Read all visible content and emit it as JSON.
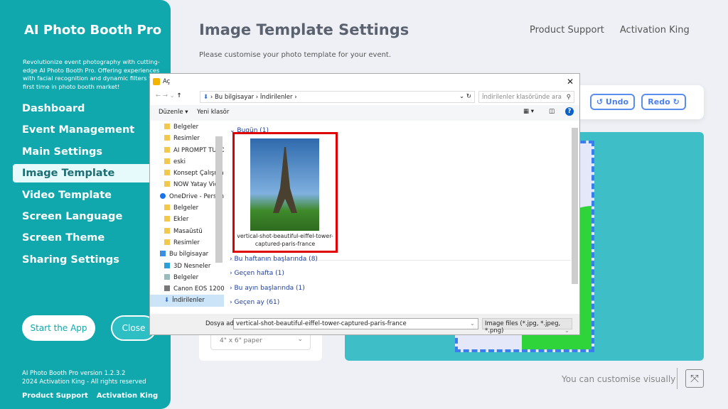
{
  "sidebar": {
    "brand": "AI Photo Booth Pro",
    "description": "Revolutionize event photography with cutting-edge AI Photo Booth Pro. Offering experiences with facial recognition and dynamic filters for the first time in photo booth market!",
    "items": [
      {
        "label": "Dashboard"
      },
      {
        "label": "Event Management"
      },
      {
        "label": "Main Settings"
      },
      {
        "label": "Image Template",
        "active": true
      },
      {
        "label": "Video Template"
      },
      {
        "label": "Screen Language"
      },
      {
        "label": "Screen Theme"
      },
      {
        "label": "Sharing Settings"
      }
    ],
    "start_label": "Start the App",
    "close_label": "Close",
    "version": "AI Photo Booth Pro version 1.2.3.2",
    "copyright": "2024 Activation King - All rights reserved",
    "support_link": "Product Support",
    "king_link": "Activation King"
  },
  "header": {
    "title": "Image Template Settings",
    "subtitle": "Please customise your photo template for your event.",
    "support_link": "Product Support",
    "king_link": "Activation King"
  },
  "toolbar": {
    "undo_label": "↺ Undo",
    "redo_label": "Redo ↻"
  },
  "paper": {
    "value": "4\" x 6\" paper"
  },
  "footer": {
    "visual_text": "You can customise visually"
  },
  "dialog": {
    "title": "Aç",
    "breadcrumb": [
      "Bu bilgisayar",
      "İndirilenler"
    ],
    "search_placeholder": "İndirilenler klasöründe ara",
    "organize": "Düzenle ▾",
    "new_folder": "Yeni klasör",
    "tree": [
      {
        "label": "Belgeler"
      },
      {
        "label": "Resimler"
      },
      {
        "label": "AI PROMPT TUTO"
      },
      {
        "label": "eski"
      },
      {
        "label": "Konsept Çalışma"
      },
      {
        "label": "NOW Yatay Vide"
      },
      {
        "label": "OneDrive - Person"
      },
      {
        "label": "Belgeler"
      },
      {
        "label": "Ekler"
      },
      {
        "label": "Masaüstü"
      },
      {
        "label": "Resimler"
      },
      {
        "label": "Bu bilgisayar"
      },
      {
        "label": "3D Nesneler"
      },
      {
        "label": "Belgeler"
      },
      {
        "label": "Canon EOS 1200"
      },
      {
        "label": "İndirilenler",
        "selected": true
      }
    ],
    "groups": [
      {
        "label": "Bugün (1)"
      },
      {
        "label": "Bu haftanın başlarında (8)"
      },
      {
        "label": "Geçen hafta (1)"
      },
      {
        "label": "Bu ayın başlarında (1)"
      },
      {
        "label": "Geçen ay (61)"
      }
    ],
    "file_name": "vertical-shot-beautiful-eiffel-tower-captured-paris-france",
    "filename_label": "Dosya adı:",
    "filename_value": "vertical-shot-beautiful-eiffel-tower-captured-paris-france",
    "filetype": "Image files (*.jpg, *.jpeg, *.png)"
  }
}
